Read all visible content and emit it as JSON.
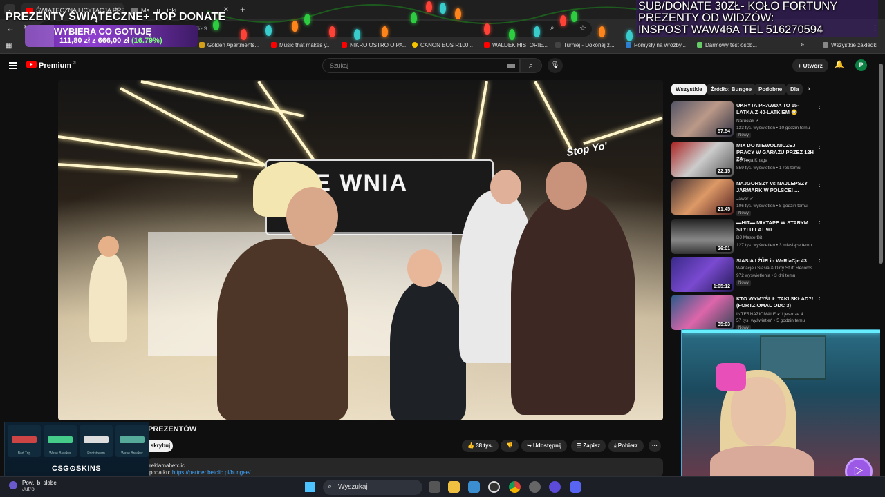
{
  "browser": {
    "tabs": [
      {
        "label": "ŚWIĄTECZNA LICYTACJA PREZ...",
        "active": true
      },
      {
        "label": "Ma... u... inki",
        "active": false
      }
    ],
    "new_tab": "+",
    "bookmarks": [
      {
        "label": "Golden Apartments...",
        "color": "#d4a017"
      },
      {
        "label": "Music that makes y...",
        "color": "#ff0000"
      },
      {
        "label": "NIKRO OSTRO O PA...",
        "color": "#ff0000"
      },
      {
        "label": "CANON EOS R100...",
        "color": "#f5c400"
      },
      {
        "label": "WALDEK HISTORIE...",
        "color": "#ff0000"
      },
      {
        "label": "Turniej - Dokonaj z...",
        "color": "#444"
      },
      {
        "label": "Pomysły na wróżby...",
        "color": "#2d7dd2"
      },
      {
        "label": "Darmowy test osob...",
        "color": "#6c6"
      },
      {
        "label": "Wszystkie zakładki",
        "color": "#888"
      }
    ],
    "address_fragment": "... 14&t=62s"
  },
  "stream_overlay": {
    "donate_title": "PREZENTY ŚWIĄTECZNE+ TOP DONATE",
    "goal_title": "WYBIERA CO GOTUJĘ",
    "goal_amount": "111,80 zł z 666,00 zł",
    "goal_percent": "(16.79%)",
    "goal_fraction": 0.1679,
    "subdonate_line1": "SUB/DONATE 30ZŁ- KOŁO FORTUNY",
    "subdonate_line2": "PREZENTY OD WIDZÓW:",
    "subdonate_line3": "INSPOST WAW46A TEL 516270594"
  },
  "youtube": {
    "logo": "Premium",
    "logo_region": "PL",
    "search_placeholder": "Szukaj",
    "create_label": "Utwórz",
    "avatar_letter": "P",
    "video": {
      "store_sign": "ASE WNIA",
      "store_sign_2": "Stop Yo'",
      "title": "PREZENTÓW",
      "subscribe_label": "skrybuj",
      "likes": "38 tys.",
      "share": "Udostępnij",
      "save": "Zapisz",
      "download": "Pobierz",
      "more": "···",
      "desc_line1": "reklamabetclic",
      "desc_line2_prefix": "podatku: ",
      "desc_link": "https://partner.betclic.pl/bungee/"
    },
    "chips": [
      {
        "label": "Wszystkie",
        "active": true
      },
      {
        "label": "Źródło: Bungee",
        "active": false
      },
      {
        "label": "Podobne",
        "active": false
      },
      {
        "label": "Dla",
        "active": false
      }
    ],
    "recommendations": [
      {
        "title": "UKRYTA PRAWDA TO 15-LATKA Z 40-LATKIEM 😳",
        "channel": "Naruciak ✔",
        "meta": "133 tys. wyświetleń • 10 godzin temu",
        "badge": "Nowy",
        "duration": "57:54"
      },
      {
        "title": "MIX DO NIEWOLNICZEJ PRACY W GARAŻU PRZEZ 12H ZA ...",
        "channel": "DJ Tęga Knaga",
        "meta": "859 tys. wyświetleń • 1 rok temu",
        "badge": "",
        "duration": "22:15"
      },
      {
        "title": "NAJGORSZY vs NAJLEPSZY JARMARK W POLSCE! ...",
        "channel": "Jawor ✔",
        "meta": "106 tys. wyświetleń • 8 godzin temu",
        "badge": "Nowy",
        "duration": "21:45"
      },
      {
        "title": "▬HIT▬ MIXTAPE W STARYM STYLU LAT 90",
        "channel": "DJ MasterBit",
        "meta": "127 tys. wyświetleń • 3 miesiące temu",
        "badge": "",
        "duration": "26:01"
      },
      {
        "title": "SIASIA I ŻÜR in WaRiaCje #3",
        "channel": "Wariacje i Siasia & Dirty Stuff Records",
        "meta": "972 wyświetlenia • 3 dni temu",
        "badge": "Nowy",
        "duration": "1:05:12"
      },
      {
        "title": "KTO WYMYŚLIŁ TAKI SKŁAD?! (FORTZIOMAL ODC 3)",
        "channel": "INTERNAZIOMALE ✔ i jeszcze 4",
        "meta": "57 tys. wyświetleń • 5 godzin temu",
        "badge": "Nowy",
        "duration": "35:03"
      }
    ]
  },
  "csgo": {
    "logo": "CSG⊙SKINS",
    "skins": [
      {
        "name": "Bad Trip",
        "color": "#c44"
      },
      {
        "name": "Wave Breaker",
        "color": "#4c8"
      },
      {
        "name": "Printstream",
        "color": "#ddd"
      },
      {
        "name": "Wave Breaker",
        "color": "#5a9"
      }
    ]
  },
  "taskbar": {
    "weather_line1": "Pow.: b. słabe",
    "weather_line2": "Jutro",
    "search_label": "Wyszukaj"
  }
}
